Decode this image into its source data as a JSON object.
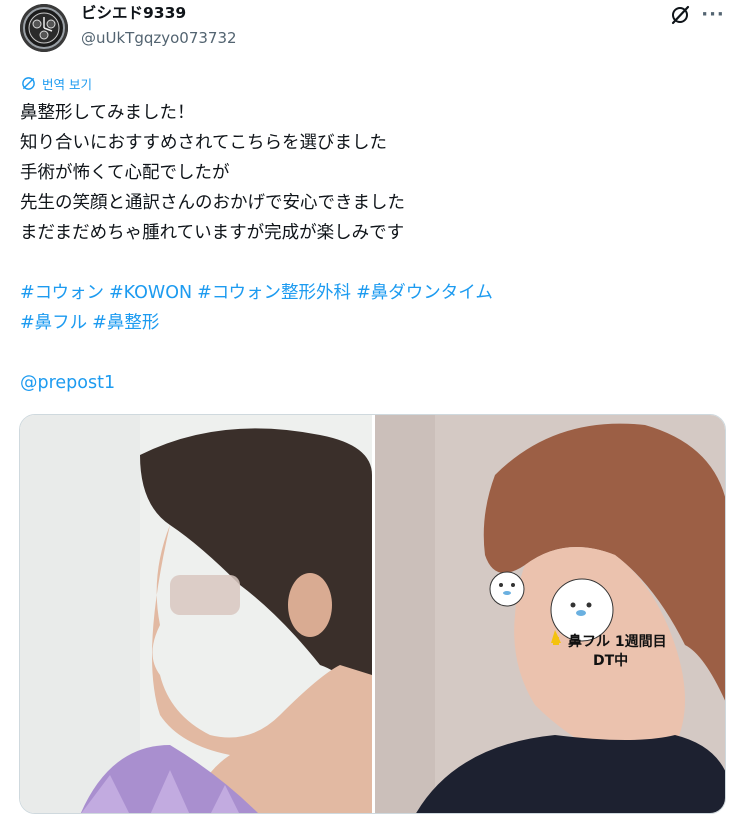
{
  "author": {
    "display_name": "ビシエド9339",
    "handle": "@uUkTgqzyo073732"
  },
  "header_icons": [
    "grok-icon",
    "more-icon"
  ],
  "translate_label": "번역 보기",
  "body_lines": [
    "鼻整形してみました！",
    "知り合いにおすすめされてこちらを選びました",
    "手術が怖くて心配でしたが",
    "先生の笑顔と通訳さんのおかげで安心できました",
    "まだまだめちゃ腫れていますが完成が楽しみです"
  ],
  "hashtags_line1": [
    "#コウォン",
    "#KOWON",
    "#コウォン整形外科",
    "#鼻ダウンタイム"
  ],
  "hashtags_line2": [
    "#鼻フル",
    "#鼻整形"
  ],
  "mention": "@prepost1",
  "photo_overlay": {
    "line1": "鼻フル 1週間目",
    "line2": "DT中"
  },
  "colors": {
    "accent": "#1d9bf0",
    "text": "#0f1419",
    "secondary": "#536471"
  }
}
